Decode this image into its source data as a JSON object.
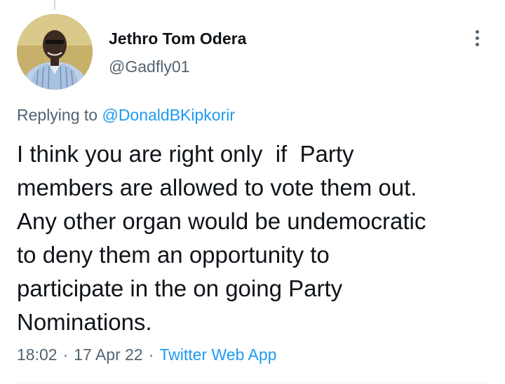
{
  "tweet": {
    "author": {
      "display_name": "Jethro Tom Odera",
      "handle": "@Gadfly01"
    },
    "replying_prefix": "Replying to",
    "replying_to": "@DonaldBKipkorir",
    "text": "I think you are right only  if  Party\nmembers are allowed to vote them out.\nAny other organ would be undemocratic\nto deny them an opportunity to\nparticipate in the on going Party\nNominations.",
    "time": "18:02",
    "date": "17 Apr 22",
    "separator": "·",
    "source": "Twitter Web App"
  },
  "icons": {
    "more": "more-vertical-icon"
  },
  "colors": {
    "accent": "#1d9bf0",
    "secondary_text": "#536471",
    "primary_text": "#0f1419"
  }
}
